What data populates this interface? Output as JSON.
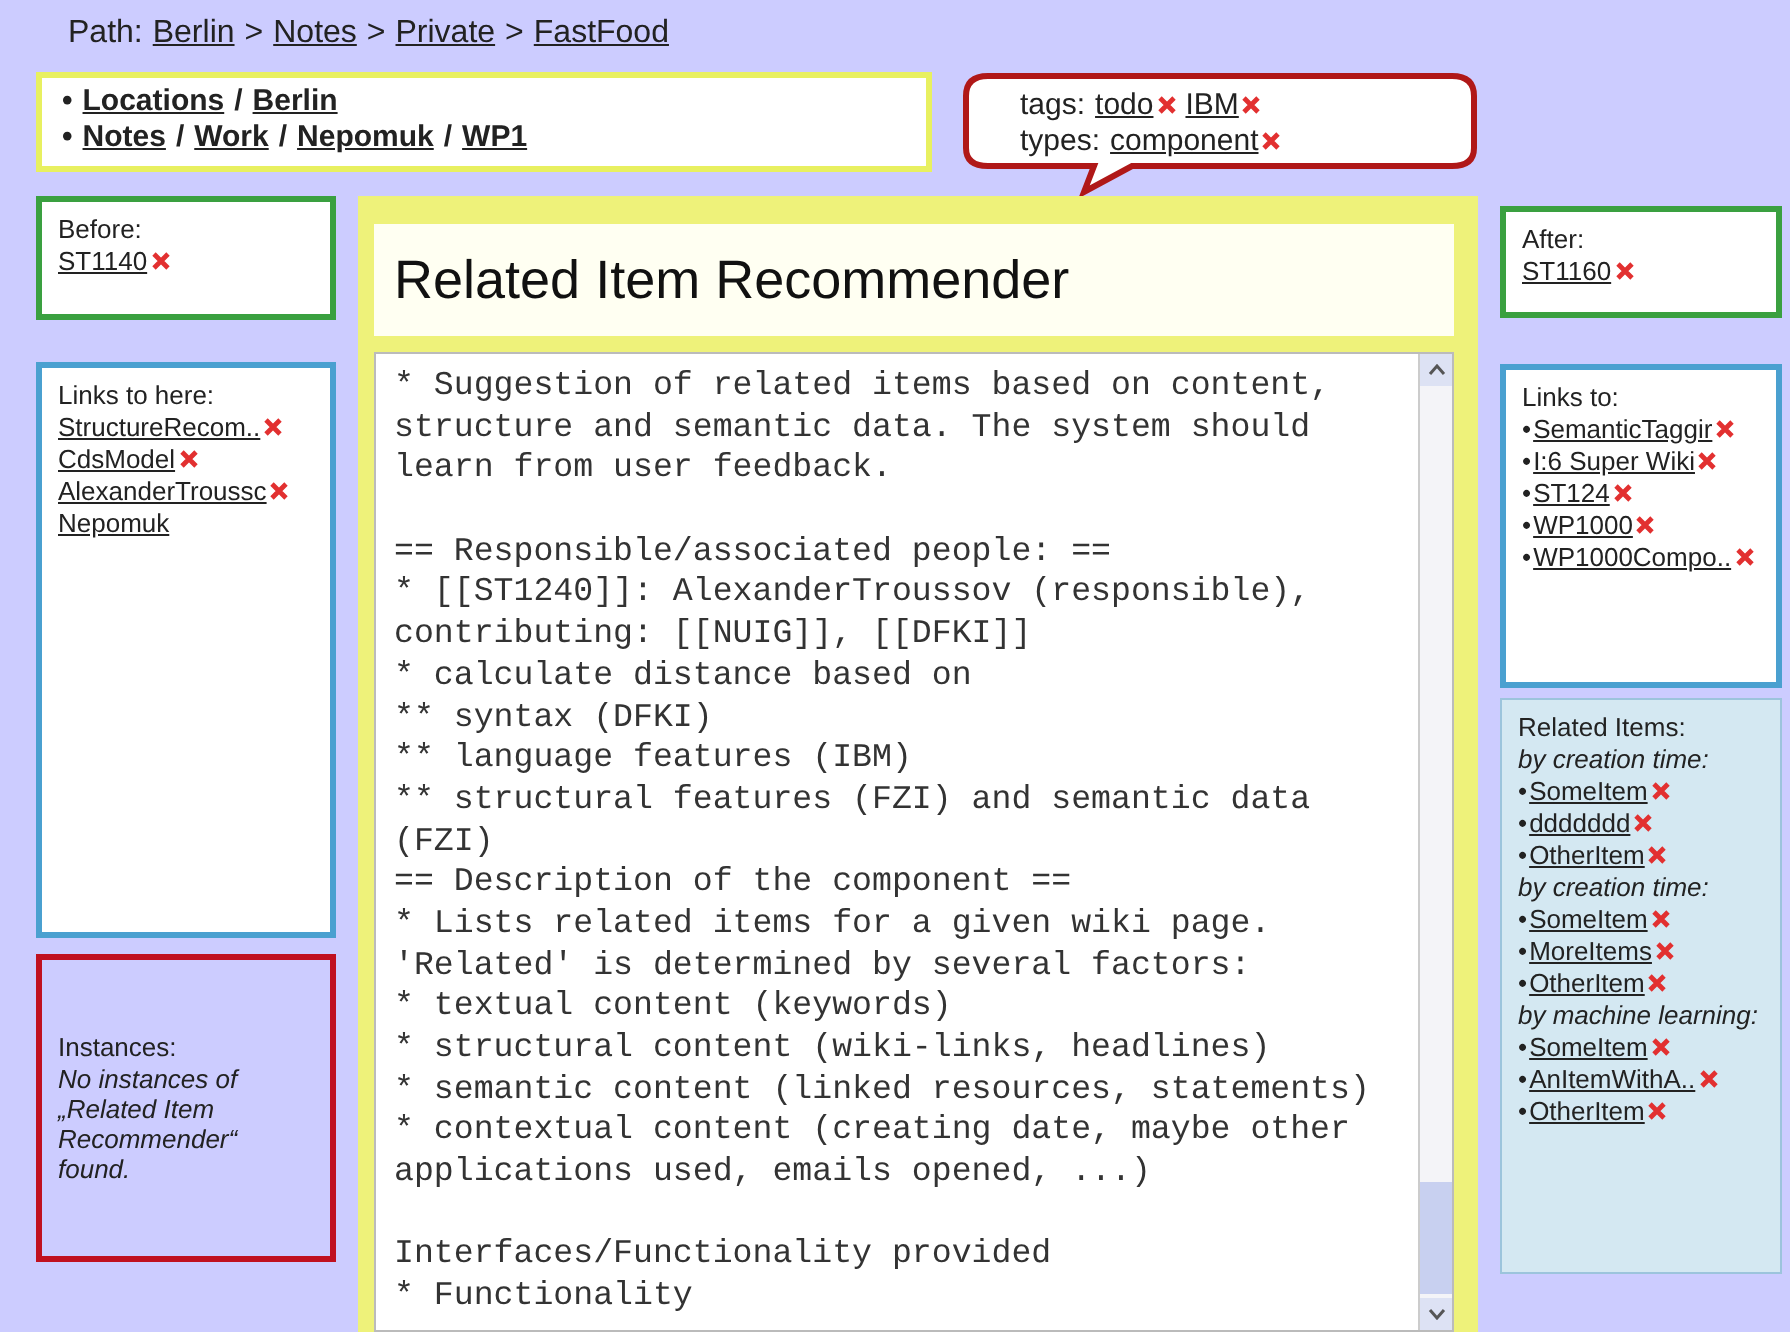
{
  "path": {
    "label": "Path:",
    "separator": ">",
    "items": [
      "Berlin",
      "Notes",
      "Private",
      "FastFood"
    ]
  },
  "categories": {
    "bullet": "•",
    "separator": "/",
    "paths": [
      [
        "Locations",
        "Berlin"
      ],
      [
        "Notes",
        "Work",
        "Nepomuk",
        "WP1"
      ]
    ]
  },
  "annotations": {
    "tags_label": "tags:",
    "tags": [
      {
        "label": "todo",
        "removable": true
      },
      {
        "label": "IBM",
        "removable": true
      }
    ],
    "types_label": "types:",
    "types": [
      {
        "label": "component",
        "removable": true
      }
    ]
  },
  "before": {
    "heading": "Before:",
    "items": [
      {
        "label": "ST1140",
        "removable": true
      }
    ]
  },
  "links_to_here": {
    "heading": "Links to here:",
    "items": [
      {
        "label": "StructureRecom..",
        "removable": true
      },
      {
        "label": "CdsModel",
        "removable": true
      },
      {
        "label": "AlexanderTroussc",
        "removable": true
      },
      {
        "label": "Nepomuk",
        "removable": false
      }
    ]
  },
  "instances": {
    "heading": "Instances:",
    "message": "No instances of „Related Item Recommender“ found."
  },
  "page": {
    "title": "Related Item Recommender",
    "blocks": [
      [
        "* Suggestion of related items based on content,",
        "structure and semantic data. The system should",
        "learn from user feedback."
      ],
      [
        "== Responsible/associated people: ==",
        "* [[ST1240]]: AlexanderTroussov (responsible),",
        "contributing: [[NUIG]], [[DFKI]]",
        "* calculate distance based on",
        "** syntax (DFKI)",
        "** language features (IBM)",
        "** structural features (FZI) and semantic data",
        "(FZI)",
        "== Description of the component ==",
        "* Lists related items for a given wiki page.",
        "'Related' is determined by several factors:",
        "* textual content (keywords)",
        "* structural content (wiki-links, headlines)",
        "* semantic content (linked resources, statements)",
        "* contextual content (creating date, maybe other",
        "applications used, emails opened, ...)"
      ],
      [
        "Interfaces/Functionality provided",
        "* Functionality"
      ]
    ]
  },
  "after": {
    "heading": "After:",
    "items": [
      {
        "label": "ST1160",
        "removable": true
      }
    ]
  },
  "links_to": {
    "heading": "Links to:",
    "bullet": "•",
    "items": [
      {
        "label": "SemanticTaggir",
        "removable": true
      },
      {
        "label": "I:6 Super Wiki",
        "removable": true
      },
      {
        "label": "ST124",
        "removable": true
      },
      {
        "label": "WP1000",
        "removable": true
      },
      {
        "label": "WP1000Compo..",
        "removable": true
      }
    ]
  },
  "related_items": {
    "heading": "Related Items:",
    "bullet": "•",
    "groups": [
      {
        "heading": "by creation time:",
        "items": [
          {
            "label": "SomeItem",
            "removable": true
          },
          {
            "label": "ddddddd",
            "removable": true
          },
          {
            "label": "OtherItem",
            "removable": true
          }
        ]
      },
      {
        "heading": "by creation time:",
        "items": [
          {
            "label": "SomeItem",
            "removable": true
          },
          {
            "label": "MoreItems",
            "removable": true
          },
          {
            "label": "OtherItem",
            "removable": true
          }
        ]
      },
      {
        "heading": "by machine learning:",
        "items": [
          {
            "label": "SomeItem",
            "removable": true
          },
          {
            "label": "AnItemWithA..",
            "removable": true
          },
          {
            "label": "OtherItem",
            "removable": true
          }
        ]
      }
    ]
  }
}
